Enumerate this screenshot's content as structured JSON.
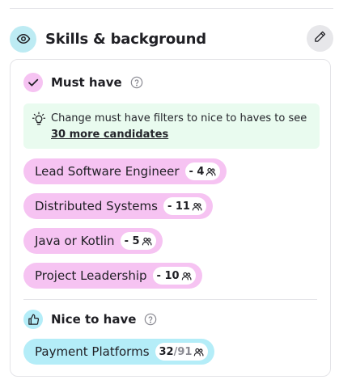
{
  "section": {
    "title": "Skills & background",
    "header_icon": "eye-icon",
    "edit_icon": "pencil-icon"
  },
  "must_have": {
    "label": "Must have",
    "icon": "check-icon",
    "hint": {
      "text": "Change must have filters to nice to haves to see",
      "link": "30 more candidates"
    },
    "chips": [
      {
        "label": "Lead Software Engineer",
        "count": "- 4"
      },
      {
        "label": "Distributed Systems",
        "count": "- 11"
      },
      {
        "label": "Java or Kotlin",
        "count": "- 5"
      },
      {
        "label": "Project Leadership",
        "count": "- 10"
      }
    ]
  },
  "nice_to_have": {
    "label": "Nice to have",
    "icon": "thumbs-up-icon",
    "chips": [
      {
        "label": "Payment Platforms",
        "count_value": "32",
        "count_total": "/91"
      }
    ]
  },
  "colors": {
    "must_chip": "#f6c3f2",
    "nice_chip": "#b4edf8",
    "hint_bg": "#e9fbef"
  }
}
